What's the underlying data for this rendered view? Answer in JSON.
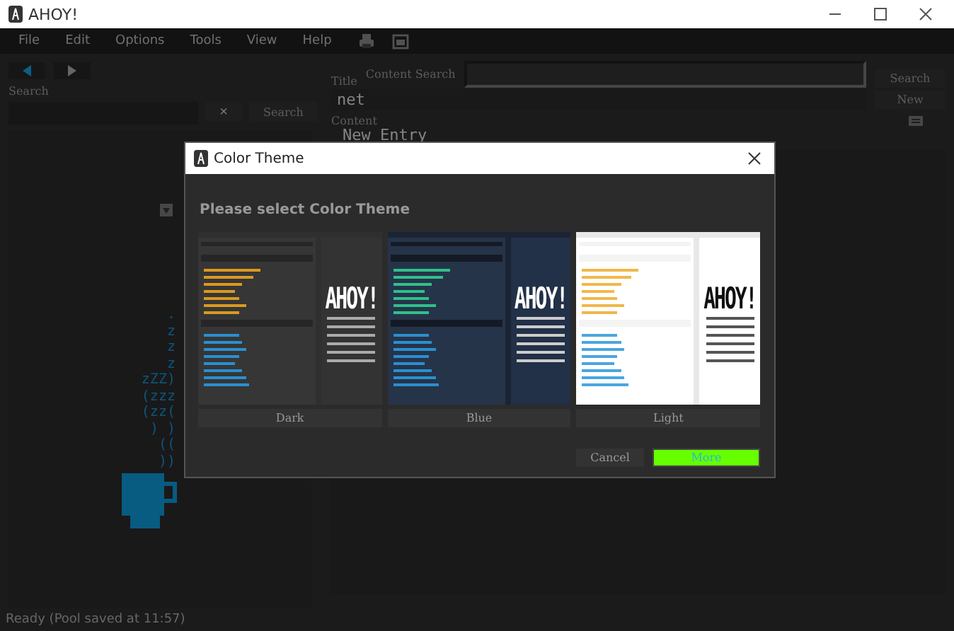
{
  "window": {
    "title": "AHOY!"
  },
  "menu": [
    "File",
    "Edit",
    "Options",
    "Tools",
    "View",
    "Help"
  ],
  "left_panel": {
    "search_label": "Search",
    "clear_button": "×",
    "search_button": "Search",
    "steam_art": [
      ".",
      "z",
      "z",
      "z",
      "zZZ)",
      "(zzz",
      "(zz(",
      ") )",
      "((",
      "))"
    ]
  },
  "editor": {
    "title_label": "Title",
    "title_value": "net",
    "content_label": "Content",
    "content_value": "New Entry",
    "content_search_label": "Content Search",
    "search_button": "Search",
    "new_button": "New"
  },
  "dialog": {
    "title": "Color Theme",
    "heading": "Please select Color Theme",
    "themes": [
      {
        "kind": "dark",
        "label": "Dark",
        "preview_logo": "AHOY!"
      },
      {
        "kind": "blue",
        "label": "Blue",
        "preview_logo": "AHOY!"
      },
      {
        "kind": "light",
        "label": "Light",
        "preview_logo": "AHOY!"
      }
    ],
    "cancel_button": "Cancel",
    "more_button": "More"
  },
  "status_bar": "Ready (Pool saved at 11:57)"
}
